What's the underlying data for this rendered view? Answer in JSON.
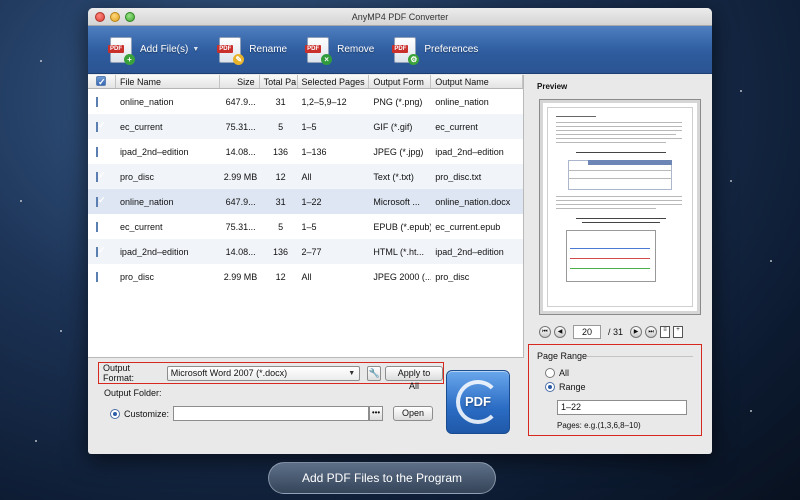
{
  "window": {
    "title": "AnyMP4 PDF Converter"
  },
  "toolbar": {
    "add_label": "Add File(s)",
    "rename_label": "Rename",
    "remove_label": "Remove",
    "preferences_label": "Preferences",
    "icon_text": "PDF"
  },
  "table": {
    "headers": [
      "File Name",
      "Size",
      "Total Pa",
      "Selected Pages",
      "Output Form",
      "Output Name"
    ],
    "rows": [
      {
        "name": "online_nation",
        "size": "647.9...",
        "total": "31",
        "selected": "1,2–5,9–12",
        "format": "PNG (*.png)",
        "output": "online_nation"
      },
      {
        "name": "ec_current",
        "size": "75.31...",
        "total": "5",
        "selected": "1–5",
        "format": "GIF (*.gif)",
        "output": "ec_current"
      },
      {
        "name": "ipad_2nd–edition",
        "size": "14.08...",
        "total": "136",
        "selected": "1–136",
        "format": "JPEG (*.jpg)",
        "output": "ipad_2nd–edition"
      },
      {
        "name": "pro_disc",
        "size": "2.99 MB",
        "total": "12",
        "selected": "All",
        "format": "Text (*.txt)",
        "output": "pro_disc.txt"
      },
      {
        "name": "online_nation",
        "size": "647.9...",
        "total": "31",
        "selected": "1–22",
        "format": "Microsoft ...",
        "output": "online_nation.docx"
      },
      {
        "name": "ec_current",
        "size": "75.31...",
        "total": "5",
        "selected": "1–5",
        "format": "EPUB (*.epub)",
        "output": "ec_current.epub"
      },
      {
        "name": "ipad_2nd–edition",
        "size": "14.08...",
        "total": "136",
        "selected": "2–77",
        "format": "HTML (*.ht...",
        "output": "ipad_2nd–edition"
      },
      {
        "name": "pro_disc",
        "size": "2.99 MB",
        "total": "12",
        "selected": "All",
        "format": "JPEG 2000 (...",
        "output": "pro_disc"
      }
    ]
  },
  "preview": {
    "title": "Preview",
    "current_page": "20",
    "total_pages": "/ 31"
  },
  "output": {
    "format_label": "Output Format:",
    "format_value": "Microsoft Word 2007 (*.docx)",
    "apply_label": "Apply to All",
    "folder_label": "Output Folder:",
    "customize_label": "Customize:",
    "path_value": "",
    "browse_label": "•••",
    "open_label": "Open"
  },
  "convert": {
    "label": "PDF"
  },
  "page_range": {
    "title": "Page Range",
    "all_label": "All",
    "range_label": "Range",
    "range_value": "1–22",
    "hint": "Pages: e.g.(1,3,6,8–10)"
  },
  "footer": {
    "label": "Add PDF Files to the Program"
  }
}
